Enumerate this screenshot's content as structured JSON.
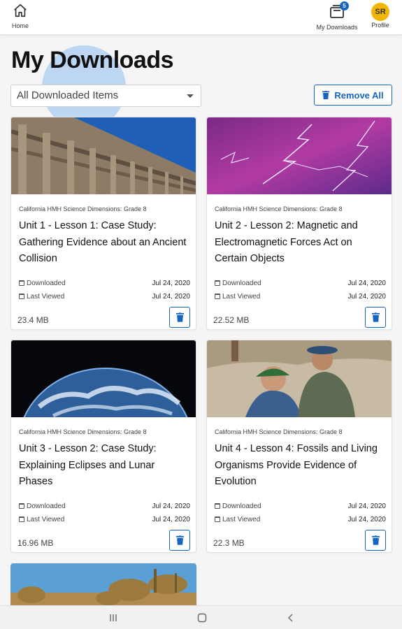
{
  "topbar": {
    "home_label": "Home",
    "downloads_label": "My Downloads",
    "downloads_badge": "5",
    "profile_label": "Profile",
    "profile_initials": "SR"
  },
  "page": {
    "title": "My Downloads",
    "filter": {
      "selected": "All Downloaded Items"
    },
    "remove_all_label": "Remove All"
  },
  "labels": {
    "downloaded": "Downloaded",
    "last_viewed": "Last Viewed"
  },
  "cards": [
    {
      "course": "California HMH Science Dimensions: Grade 8",
      "title": "Unit 1 - Lesson 1: Case Study: Gathering Evidence about an Ancient Collision",
      "downloaded": "Jul 24, 2020",
      "last_viewed": "Jul 24, 2020",
      "size": "23.4 MB",
      "image": "concrete-building-photo"
    },
    {
      "course": "California HMH Science Dimensions: Grade 8",
      "title": "Unit 2 - Lesson 2: Magnetic and Electromagnetic Forces Act on Certain Objects",
      "downloaded": "Jul 24, 2020",
      "last_viewed": "Jul 24, 2020",
      "size": "22.52 MB",
      "image": "lightning-sky-photo"
    },
    {
      "course": "California HMH Science Dimensions: Grade 8",
      "title": "Unit 3 - Lesson 2: Case Study: Explaining Eclipses and Lunar Phases",
      "downloaded": "Jul 24, 2020",
      "last_viewed": "Jul 24, 2020",
      "size": "16.96 MB",
      "image": "earth-from-space-photo"
    },
    {
      "course": "California HMH Science Dimensions: Grade 8",
      "title": "Unit 4 - Lesson 4: Fossils and Living Organisms Provide Evidence of Evolution",
      "downloaded": "Jul 24, 2020",
      "last_viewed": "Jul 24, 2020",
      "size": "22.3 MB",
      "image": "fossil-dig-photo"
    }
  ],
  "partial_card": {
    "image": "desert-plants-photo"
  },
  "colors": {
    "accent": "#1565c0",
    "avatar": "#f2b705",
    "deco_circle": "#bcd6f3"
  },
  "icons": [
    "home-icon",
    "downloads-icon",
    "trash-icon",
    "calendar-icon",
    "recents-nav-icon",
    "home-nav-icon",
    "back-nav-icon"
  ]
}
